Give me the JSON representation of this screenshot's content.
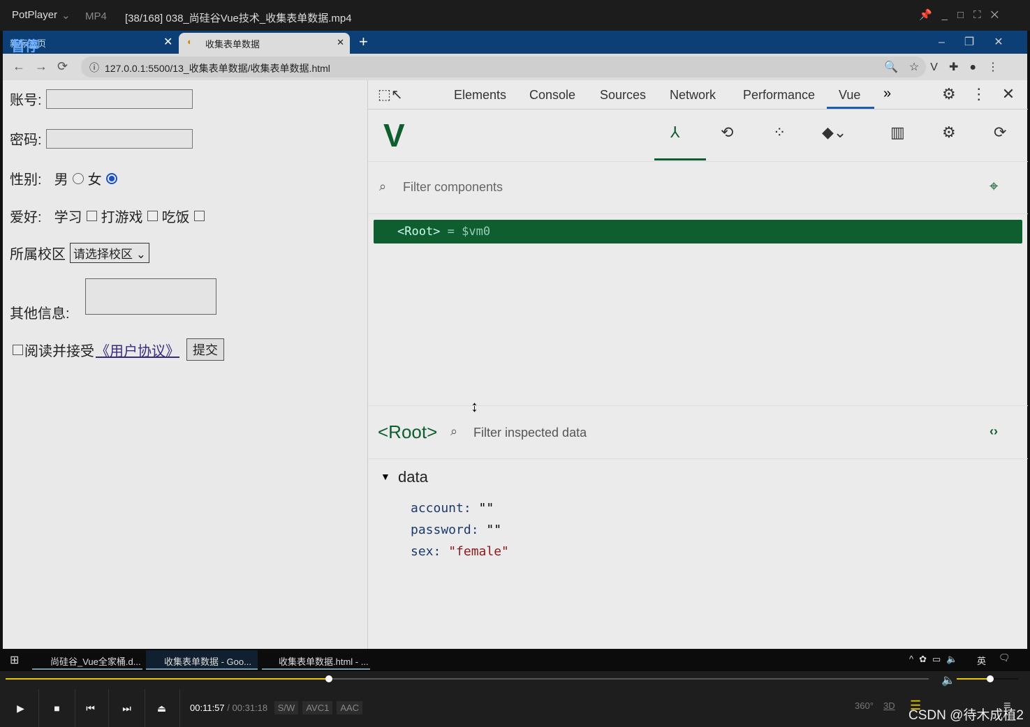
{
  "player": {
    "app": "PotPlayer",
    "format": "MP4",
    "title": "[38/168] 038_尚硅谷Vue技术_收集表单数据.mp4",
    "paused_label": "暂停",
    "current_time": "00:11:57",
    "total_time": "00:31:18",
    "badges": [
      "S/W",
      "AVC1",
      "AAC"
    ],
    "progress": 0.35,
    "volume": 0.55,
    "watermark": "CSDN @待木成植2",
    "extra_buttons": [
      "360°",
      "3D"
    ]
  },
  "browser": {
    "tabs": [
      {
        "label": "新标签页"
      },
      {
        "label": "收集表单数据"
      }
    ],
    "url": "127.0.0.1:5500/13_收集表单数据/收集表单数据.html"
  },
  "form": {
    "account_label": "账号:",
    "password_label": "密码:",
    "sex_label": "性别:",
    "male": "男",
    "female": "女",
    "sex_value": "female",
    "hobby_label": "爱好:",
    "hobbies": [
      "学习",
      "打游戏",
      "吃饭"
    ],
    "campus_label": "所属校区",
    "campus_select": "请选择校区",
    "other_label": "其他信息:",
    "agree_text": "阅读并接受",
    "agreement_link": "《用户协议》",
    "submit": "提交"
  },
  "devtools": {
    "tabs": [
      "Elements",
      "Console",
      "Sources",
      "Network",
      "Performance",
      "Vue"
    ],
    "active_tab": "Vue",
    "filter_components_placeholder": "Filter components",
    "root_node": "<Root>",
    "root_var": "= $vm0",
    "inspected_title": "<Root>",
    "filter_data_placeholder": "Filter inspected data",
    "section": "data",
    "data": [
      {
        "key": "account:",
        "value": "\"\""
      },
      {
        "key": "password:",
        "value": "\"\""
      },
      {
        "key": "sex:",
        "value": "\"female\""
      }
    ]
  },
  "taskbar": {
    "items": [
      "尚硅谷_Vue全家桶.d...",
      "收集表单数据 - Goo...",
      "收集表单数据.html - ..."
    ],
    "ime": "英"
  },
  "colors": {
    "vue_green": "#0f5e2f",
    "accent_yellow": "#e8c800",
    "tab_blue": "#0b3f75"
  }
}
